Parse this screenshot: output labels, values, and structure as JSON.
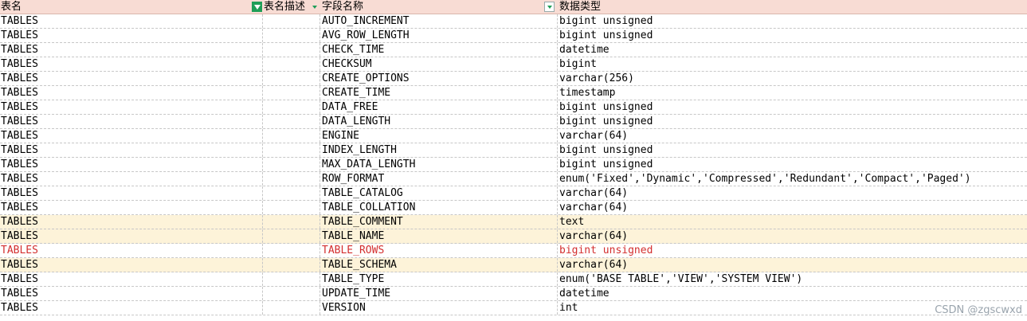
{
  "columns": [
    "表名",
    "表名描述",
    "字段名称",
    "数据类型"
  ],
  "rows": [
    {
      "table": "TABLES",
      "desc": "",
      "field": "AUTO_INCREMENT",
      "type": "bigint unsigned"
    },
    {
      "table": "TABLES",
      "desc": "",
      "field": "AVG_ROW_LENGTH",
      "type": "bigint unsigned"
    },
    {
      "table": "TABLES",
      "desc": "",
      "field": "CHECK_TIME",
      "type": "datetime"
    },
    {
      "table": "TABLES",
      "desc": "",
      "field": "CHECKSUM",
      "type": "bigint"
    },
    {
      "table": "TABLES",
      "desc": "",
      "field": "CREATE_OPTIONS",
      "type": "varchar(256)"
    },
    {
      "table": "TABLES",
      "desc": "",
      "field": "CREATE_TIME",
      "type": "timestamp"
    },
    {
      "table": "TABLES",
      "desc": "",
      "field": "DATA_FREE",
      "type": "bigint unsigned"
    },
    {
      "table": "TABLES",
      "desc": "",
      "field": "DATA_LENGTH",
      "type": "bigint unsigned"
    },
    {
      "table": "TABLES",
      "desc": "",
      "field": "ENGINE",
      "type": "varchar(64)"
    },
    {
      "table": "TABLES",
      "desc": "",
      "field": "INDEX_LENGTH",
      "type": "bigint unsigned"
    },
    {
      "table": "TABLES",
      "desc": "",
      "field": "MAX_DATA_LENGTH",
      "type": "bigint unsigned"
    },
    {
      "table": "TABLES",
      "desc": "",
      "field": "ROW_FORMAT",
      "type": "enum('Fixed','Dynamic','Compressed','Redundant','Compact','Paged')"
    },
    {
      "table": "TABLES",
      "desc": "",
      "field": "TABLE_CATALOG",
      "type": "varchar(64)"
    },
    {
      "table": "TABLES",
      "desc": "",
      "field": "TABLE_COLLATION",
      "type": "varchar(64)"
    },
    {
      "table": "TABLES",
      "desc": "",
      "field": "TABLE_COMMENT",
      "type": "text",
      "highlight": true
    },
    {
      "table": "TABLES",
      "desc": "",
      "field": "TABLE_NAME",
      "type": "varchar(64)",
      "highlight": true
    },
    {
      "table": "TABLES",
      "desc": "",
      "field": "TABLE_ROWS",
      "type": "bigint unsigned",
      "red": true
    },
    {
      "table": "TABLES",
      "desc": "",
      "field": "TABLE_SCHEMA",
      "type": "varchar(64)",
      "highlight": true
    },
    {
      "table": "TABLES",
      "desc": "",
      "field": "TABLE_TYPE",
      "type": "enum('BASE TABLE','VIEW','SYSTEM VIEW')"
    },
    {
      "table": "TABLES",
      "desc": "",
      "field": "UPDATE_TIME",
      "type": "datetime"
    },
    {
      "table": "TABLES",
      "desc": "",
      "field": "VERSION",
      "type": "int"
    }
  ],
  "watermark": "CSDN @zgscwxd",
  "colors": {
    "header_bg": "#f8dcd4",
    "highlight_bg": "#fdf3d9",
    "red_text": "#d32f2f",
    "filter_active": "#1f9e57"
  },
  "icons": {
    "filter_active": "filter-icon",
    "dropdown": "dropdown-arrow-icon"
  }
}
